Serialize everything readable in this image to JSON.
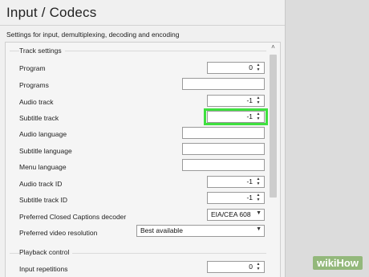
{
  "header": {
    "title": "Input / Codecs",
    "subtitle": "Settings for input, demultiplexing, decoding and encoding"
  },
  "track_settings": {
    "group_title": "Track settings",
    "program": {
      "label": "Program",
      "value": "0"
    },
    "programs": {
      "label": "Programs",
      "value": ""
    },
    "audio_track": {
      "label": "Audio track",
      "value": "-1"
    },
    "subtitle_track": {
      "label": "Subtitle track",
      "value": "-1"
    },
    "audio_language": {
      "label": "Audio language",
      "value": ""
    },
    "subtitle_language": {
      "label": "Subtitle language",
      "value": ""
    },
    "menu_language": {
      "label": "Menu language",
      "value": ""
    },
    "audio_track_id": {
      "label": "Audio track ID",
      "value": "-1"
    },
    "subtitle_track_id": {
      "label": "Subtitle track ID",
      "value": "-1"
    },
    "cc_decoder": {
      "label": "Preferred Closed Captions decoder",
      "value": "EIA/CEA 608"
    },
    "video_resolution": {
      "label": "Preferred video resolution",
      "value": "Best available"
    }
  },
  "playback_control": {
    "group_title": "Playback control",
    "input_repetitions": {
      "label": "Input repetitions",
      "value": "0"
    }
  },
  "watermark": {
    "wiki": "wiki",
    "how": "How"
  },
  "colors": {
    "highlight": "#3ee03e",
    "watermark_bg": "#93b87b"
  },
  "icons": {
    "spin_arrows": "spin-arrows-icon",
    "dropdown": "chevron-down-icon",
    "scroll_up": "scroll-up-icon"
  }
}
